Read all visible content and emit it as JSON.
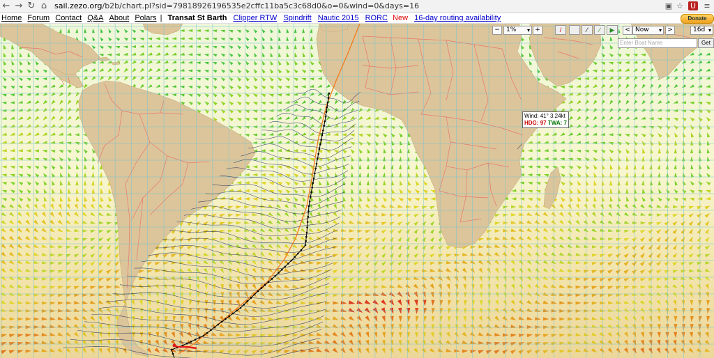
{
  "browser": {
    "url_host": "sail.zezo.org",
    "url_path": "/b2b/chart.pl?sid=79818926196535e2cffc11ba5c3c68d0&o=0&wind=0&days=16"
  },
  "menu": {
    "home": "Home",
    "forum": "Forum",
    "contact": "Contact",
    "qa": "Q&A",
    "about": "About",
    "polars": "Polars",
    "separator": "|",
    "race_current": "Transat St Barth",
    "race_links": [
      "Clipper RTW",
      "Spindrift",
      "Nautic 2015",
      "RORC"
    ],
    "new_label": "New",
    "routing_link": "16-day routing availability",
    "donate": "Donate"
  },
  "controls": {
    "zoom_out": "−",
    "zoom_value": "1%",
    "zoom_in": "+",
    "time_prev": "<",
    "time_value": "Now",
    "time_next": ">",
    "days_value": "16d",
    "boat_placeholder": "Enter Boat Name",
    "get_label": "Get"
  },
  "info": {
    "wind_label": "Wind:",
    "wind_value": "41° 3.24kt",
    "hdg_label": "HDG:",
    "hdg_value": "97",
    "twa_label": "TWA:",
    "twa_value": "7"
  },
  "colors": {
    "land": "#dcc59a",
    "border": "#e8766e",
    "grid": "#77c4cf",
    "route": "#f07a1e",
    "isochrone": "#1a2a5a"
  }
}
